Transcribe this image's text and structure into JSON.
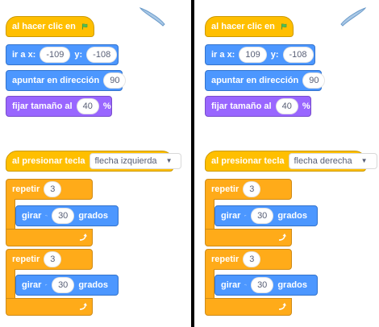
{
  "colors": {
    "events": "#FFBF00",
    "motion": "#4C97FF",
    "looks": "#9966FF",
    "control": "#FFAB19",
    "divider": "#000000"
  },
  "left": {
    "script1": {
      "when_flag_label": "al hacer clic en",
      "goto_label": "ir a x:",
      "goto_x": "-109",
      "goto_y_label": "y:",
      "goto_y": "-108",
      "point_label": "apuntar en dirección",
      "point_value": "90",
      "size_label": "fijar tamaño al",
      "size_value": "40",
      "size_unit": "%"
    },
    "script2": {
      "when_key_label": "al presionar tecla",
      "key_value": "flecha izquierda",
      "repeat1_label": "repetir",
      "repeat1_value": "3",
      "turn1_label": "girar",
      "turn1_icon": "rotate-left-icon",
      "turn1_value": "30",
      "turn1_unit": "grados",
      "repeat2_label": "repetir",
      "repeat2_value": "3",
      "turn2_label": "girar",
      "turn2_icon": "rotate-right-icon",
      "turn2_value": "30",
      "turn2_unit": "grados"
    }
  },
  "right": {
    "script1": {
      "when_flag_label": "al hacer clic en",
      "goto_label": "ir a x:",
      "goto_x": "109",
      "goto_y_label": "y:",
      "goto_y": "-108",
      "point_label": "apuntar en dirección",
      "point_value": "90",
      "size_label": "fijar tamaño al",
      "size_value": "40",
      "size_unit": "%"
    },
    "script2": {
      "when_key_label": "al presionar tecla",
      "key_value": "flecha derecha",
      "repeat1_label": "repetir",
      "repeat1_value": "3",
      "turn1_label": "girar",
      "turn1_icon": "rotate-right-icon",
      "turn1_value": "30",
      "turn1_unit": "grados",
      "repeat2_label": "repetir",
      "repeat2_value": "3",
      "turn2_label": "girar",
      "turn2_icon": "rotate-left-icon",
      "turn2_value": "30",
      "turn2_unit": "grados"
    }
  }
}
